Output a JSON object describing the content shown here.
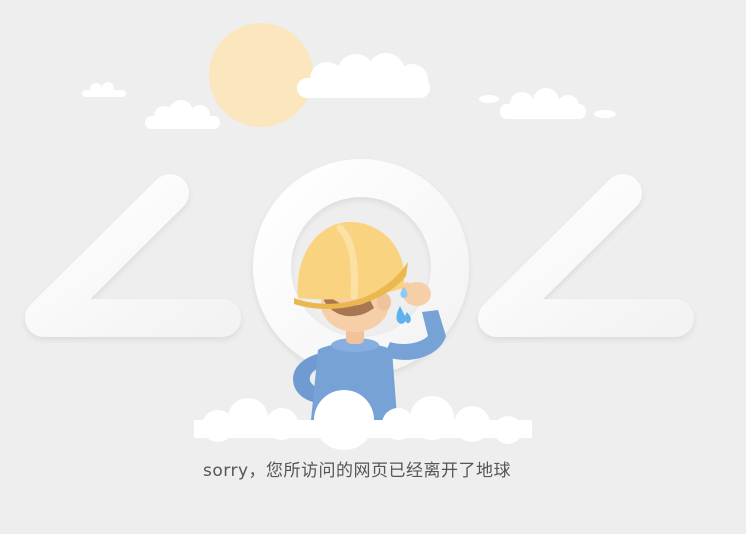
{
  "illustration": {
    "digits": [
      "4",
      "0",
      "4"
    ],
    "character_icon": "construction-worker-crying-icon"
  },
  "message": {
    "text": "sorry，您所访问的网页已经离开了地球"
  },
  "colors": {
    "background": "#eeeeee",
    "sun": "#fbe6be",
    "cloud": "#ffffff",
    "helmet": "#f9d37f",
    "helmet_brim": "#eab84f",
    "shirt": "#77a2d6",
    "skin": "#f6cfa8",
    "hair": "#a87650",
    "tear": "#5fb2ec",
    "text": "#555555"
  }
}
